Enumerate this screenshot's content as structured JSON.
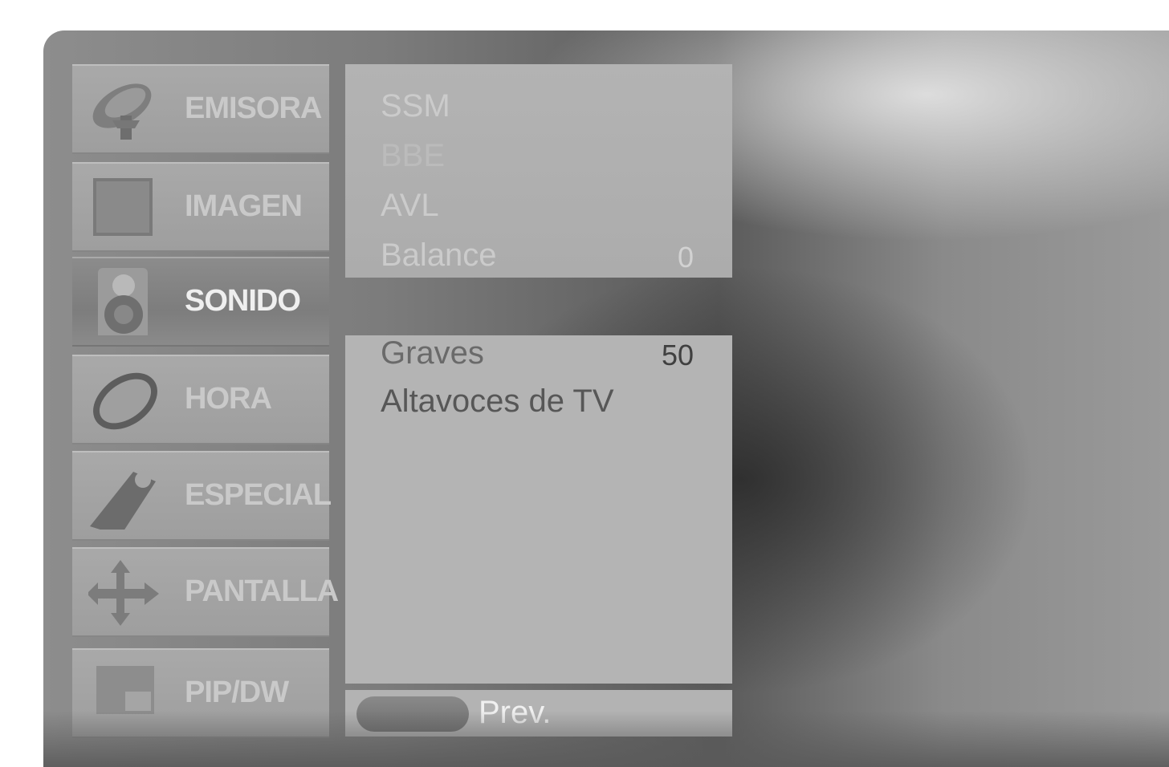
{
  "menu": {
    "categories": [
      {
        "label": "EMISORA",
        "icon": "satellite-dish-icon"
      },
      {
        "label": "IMAGEN",
        "icon": "picture-icon"
      },
      {
        "label": "SONIDO",
        "icon": "speaker-icon"
      },
      {
        "label": "HORA",
        "icon": "clock-icon"
      },
      {
        "label": "ESPECIAL",
        "icon": "tag-icon"
      },
      {
        "label": "PANTALLA",
        "icon": "arrows-icon"
      },
      {
        "label": "PIP/DW",
        "icon": "pip-screen-icon"
      }
    ],
    "selected": "SONIDO"
  },
  "submenu": {
    "items_top": [
      {
        "label": "SSM",
        "value": ""
      },
      {
        "label": "BBE",
        "value": ""
      },
      {
        "label": "AVL",
        "value": ""
      },
      {
        "label": "Balance",
        "value": "0"
      }
    ],
    "items_bottom": [
      {
        "label": "Graves",
        "value": "50"
      },
      {
        "label": "Altavoces de TV",
        "value": ""
      }
    ]
  },
  "footer": {
    "prev_label": "Prev."
  }
}
